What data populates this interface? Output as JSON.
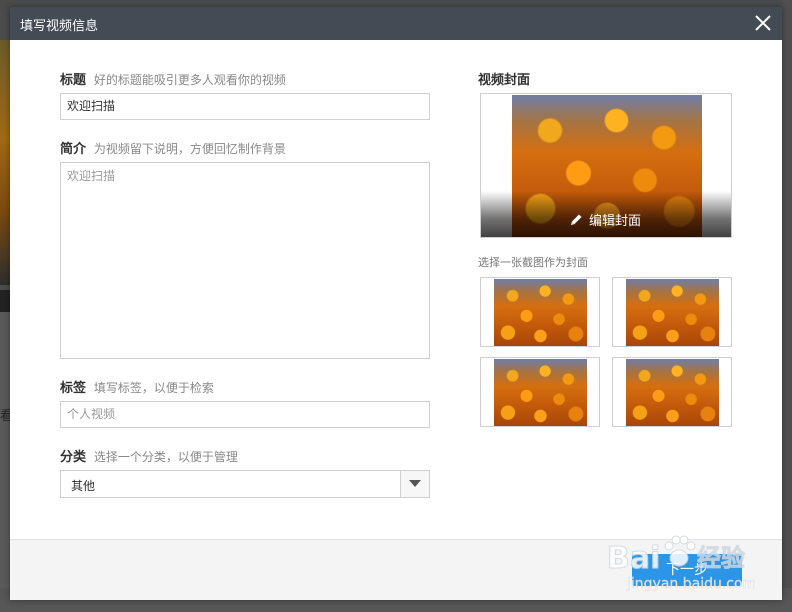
{
  "background": {
    "left_edge_char": "看"
  },
  "dialog": {
    "title": "填写视频信息",
    "close_icon": "close-icon"
  },
  "form": {
    "title": {
      "label": "标题",
      "hint": "好的标题能吸引更多人观看你的视频",
      "value": "欢迎扫描"
    },
    "description": {
      "label": "简介",
      "hint": "为视频留下说明，方便回忆制作背景",
      "value": "欢迎扫描"
    },
    "tags": {
      "label": "标签",
      "hint": "填写标签，以便于检索",
      "placeholder": "个人视频"
    },
    "category": {
      "label": "分类",
      "hint": "选择一个分类，以便于管理",
      "selected": "其他",
      "dropdown_icon": "triangle-down-icon"
    }
  },
  "cover": {
    "title": "视频封面",
    "edit_label": "编辑封面",
    "edit_icon": "pencil-icon",
    "choose_hint": "选择一张截图作为封面",
    "thumbnail_count": 4
  },
  "footer": {
    "next_label": "下一步"
  },
  "watermark": {
    "brand": "Bai",
    "brand_suffix": "经验",
    "url": "jingyan.baidu.com"
  },
  "colors": {
    "header_bg": "#434b55",
    "primary_button": "#2d95e6"
  }
}
